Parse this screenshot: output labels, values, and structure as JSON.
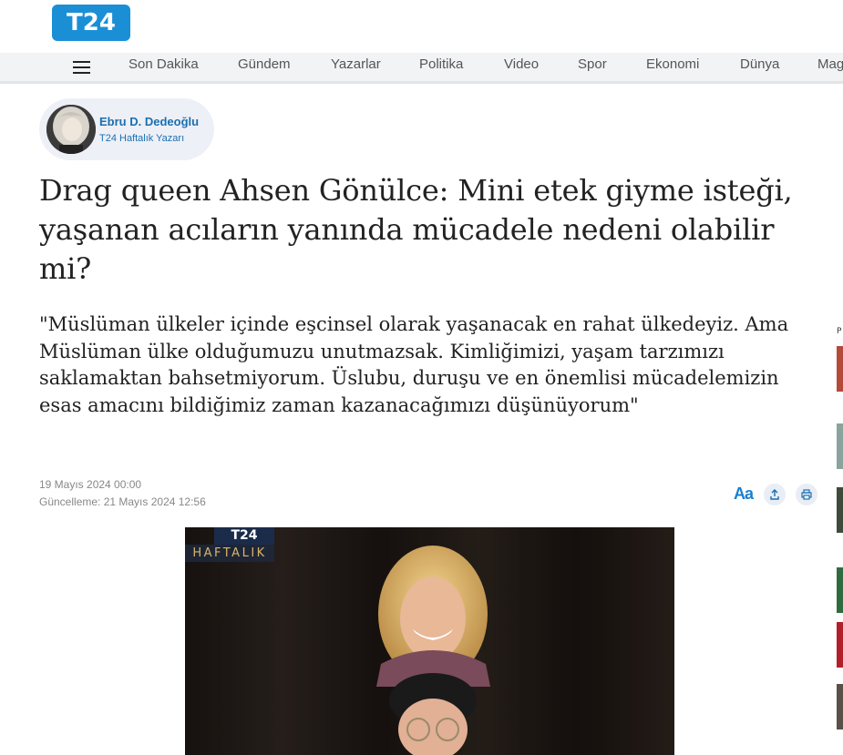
{
  "header": {
    "logo_text": "T24",
    "brand_color": "#1a8fd6"
  },
  "nav": {
    "menu_icon": "hamburger-icon",
    "items": [
      {
        "label": "Son Dakika"
      },
      {
        "label": "Gündem"
      },
      {
        "label": "Yazarlar"
      },
      {
        "label": "Politika"
      },
      {
        "label": "Video"
      },
      {
        "label": "Spor"
      },
      {
        "label": "Ekonomi"
      },
      {
        "label": "Dünya"
      },
      {
        "label": "Mag"
      }
    ]
  },
  "author": {
    "name": "Ebru D. Dedeoğlu",
    "role": "T24 Haftalık Yazarı"
  },
  "article": {
    "title": "Drag queen Ahsen Gönülce: Mini etek giyme isteği, yaşanan acıların yanında mücadele nedeni olabilir mi?",
    "quote": "\"Müslüman ülkeler içinde eşcinsel olarak yaşanacak en rahat ülkedeyiz. Ama Müslüman ülke olduğumuzu unutmazsak. Kimliğimizi, yaşam tarzımızı saklamaktan bahsetmiyorum. Üslubu, duruşu ve en önemlisi mücadelemizin esas amacını bildiğimiz zaman kazanacağımızı düşünüyorum\"",
    "published": "19 Mayıs 2024 00:00",
    "updated": "Güncelleme: 21 Mayıs 2024 12:56"
  },
  "tools": {
    "font_size_label": "Aa",
    "share_icon": "share-icon",
    "print_icon": "print-icon"
  },
  "hero_image": {
    "badge_top": "T24",
    "badge_bottom": "HAFTALIK"
  }
}
